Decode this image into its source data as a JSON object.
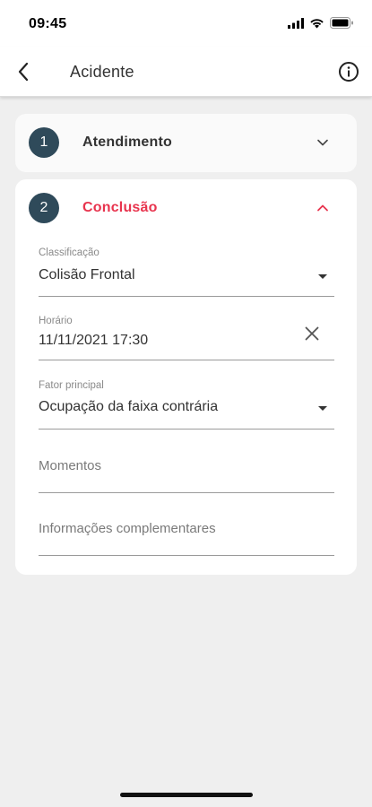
{
  "status_bar": {
    "time": "09:45"
  },
  "app_bar": {
    "title": "Acidente",
    "back_icon": "chevron-left-icon",
    "info_icon": "info-icon"
  },
  "steps": [
    {
      "number": "1",
      "title": "Atendimento",
      "expanded": false
    },
    {
      "number": "2",
      "title": "Conclusão",
      "expanded": true
    }
  ],
  "colors": {
    "accent": "#e8344e",
    "badge": "#2f4a5a",
    "background": "#efefef",
    "card": "#ffffff"
  },
  "form": {
    "classificacao": {
      "label": "Classificação",
      "value": "Colisão Frontal"
    },
    "horario": {
      "label": "Horário",
      "value": "11/11/2021 17:30"
    },
    "fator_principal": {
      "label": "Fator principal",
      "value": "Ocupação da faixa contrária"
    },
    "momentos": {
      "placeholder": "Momentos"
    },
    "informacoes": {
      "placeholder": "Informações complementares"
    }
  }
}
